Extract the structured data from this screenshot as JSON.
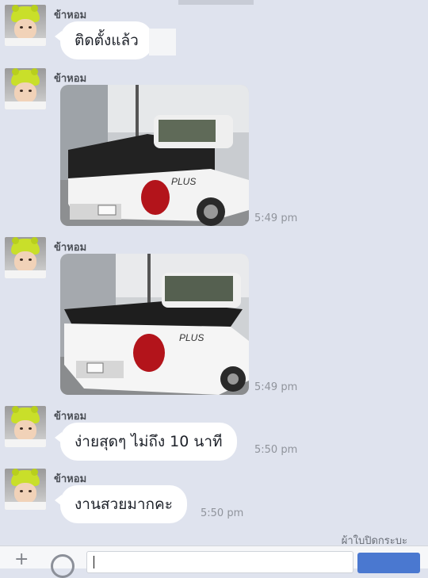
{
  "conversation": {
    "messages": [
      {
        "sender": "ข้าหอม",
        "type": "text",
        "text": "ติดตั้งแล้ว",
        "time": ""
      },
      {
        "sender": "ข้าหอม",
        "type": "image",
        "alt": "white pickup truck with black tonneau cover",
        "badge": "PLUS",
        "time": "5:49 pm"
      },
      {
        "sender": "ข้าหอม",
        "type": "image",
        "alt": "white pickup truck with black tonneau cover",
        "badge": "PLUS",
        "time": "5:49 pm"
      },
      {
        "sender": "ข้าหอม",
        "type": "text",
        "text": "ง่ายสุดๆ ไม่ถึง 10 นาที",
        "time": "5:50 pm"
      },
      {
        "sender": "ข้าหอม",
        "type": "text",
        "text": "งานสวยมากคะ",
        "time": "5:50 pm"
      }
    ],
    "footer_note": "ผ้าใบปิดกระบะ"
  },
  "composer": {
    "add_icon": "plus-icon",
    "emoji_icon": "smiley-icon",
    "send_button": ""
  },
  "colors": {
    "background": "#dfe3ee",
    "bubble": "#ffffff",
    "send": "#4a78d0"
  }
}
